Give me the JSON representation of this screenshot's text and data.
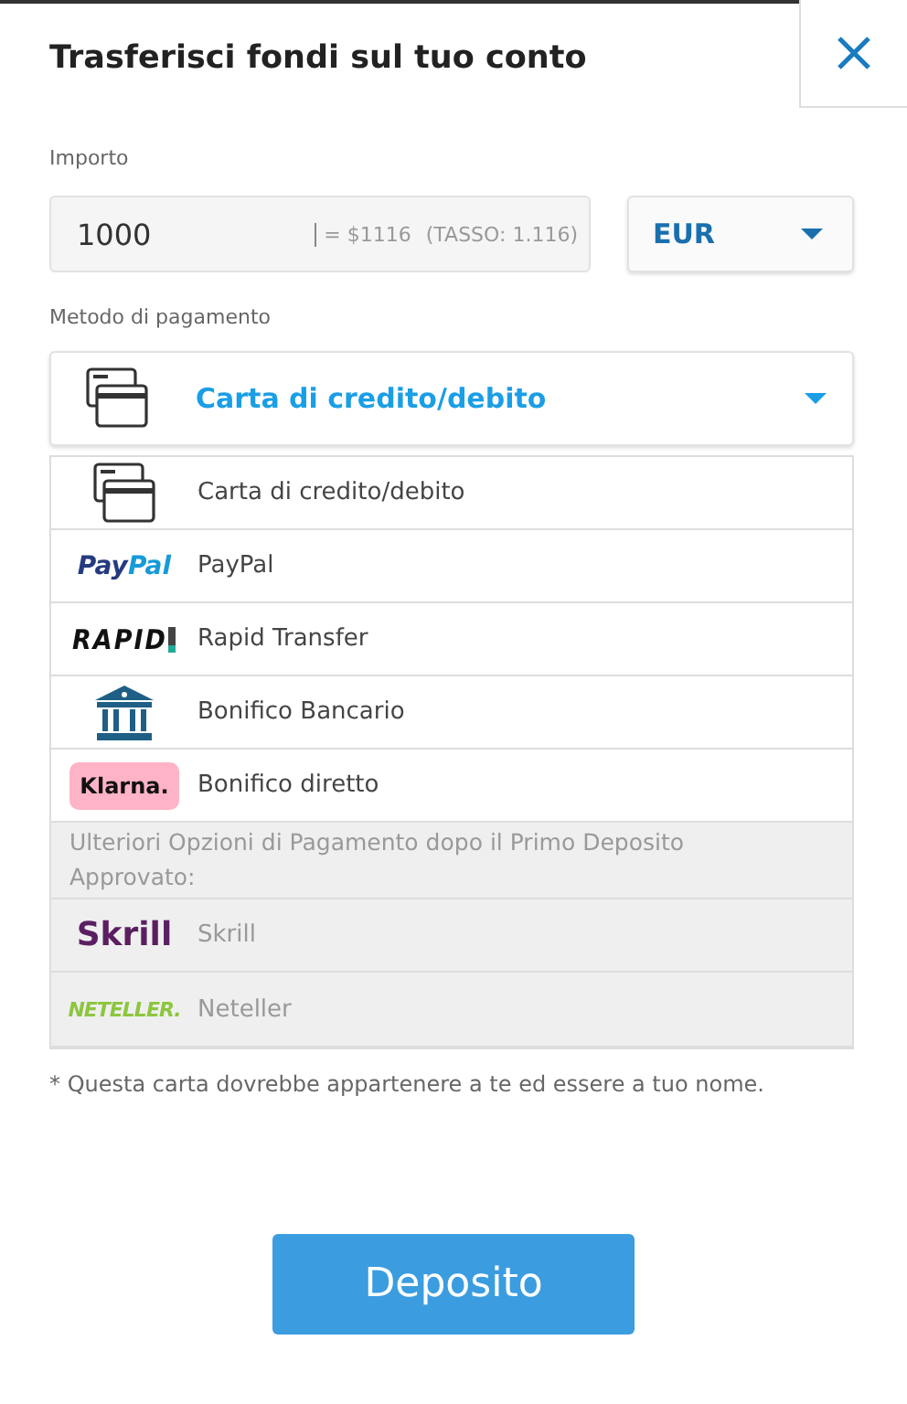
{
  "title": "Trasferisci fondi sul tuo conto",
  "amount": {
    "label": "Importo",
    "value": "1000",
    "conversion": "= $1116",
    "rate": "(TASSO: 1.116)"
  },
  "currency": {
    "value": "EUR"
  },
  "method": {
    "label": "Metodo di pagamento",
    "value": "Carta di credito/debito",
    "kind": "card"
  },
  "options": [
    {
      "kind": "card",
      "name": "Carta di credito/debito",
      "disabled": false
    },
    {
      "kind": "paypal",
      "logo_text": [
        "Pay",
        "Pal"
      ],
      "name": "PayPal",
      "disabled": false
    },
    {
      "kind": "rapid",
      "logo_text": [
        "RAPID"
      ],
      "name": "Rapid Transfer",
      "disabled": false
    },
    {
      "kind": "bank",
      "name": "Bonifico Bancario",
      "disabled": false
    },
    {
      "kind": "klarna",
      "logo_text": [
        "Klarna."
      ],
      "name": "Bonifico diretto",
      "disabled": false
    },
    {
      "kind": "note",
      "text": "Ulteriori Opzioni di Pagamento dopo il Primo Deposito Approvato:"
    },
    {
      "kind": "skrill",
      "logo_text": [
        "Skrill"
      ],
      "name": "Skrill",
      "disabled": true
    },
    {
      "kind": "neteller",
      "logo_text": [
        "NETELLER."
      ],
      "name": "Neteller",
      "disabled": true
    }
  ],
  "footnote": "* Questa carta dovrebbe appartenere a te ed essere a tuo nome.",
  "submit": "Deposito"
}
